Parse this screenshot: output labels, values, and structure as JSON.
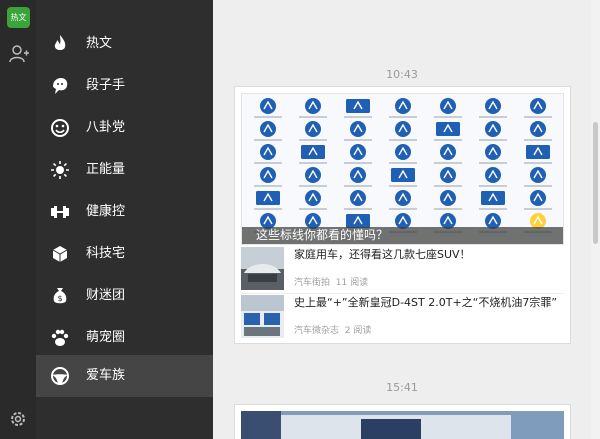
{
  "app": {
    "badge": "热文"
  },
  "categories": [
    {
      "label": "热文",
      "icon": "flame-icon",
      "selected": false
    },
    {
      "label": "段子手",
      "icon": "chat-bubble-icon",
      "selected": false
    },
    {
      "label": "八卦党",
      "icon": "smiley-icon",
      "selected": false
    },
    {
      "label": "正能量",
      "icon": "sun-icon",
      "selected": false
    },
    {
      "label": "健康控",
      "icon": "dumbbell-icon",
      "selected": false
    },
    {
      "label": "科技宅",
      "icon": "cube-icon",
      "selected": false
    },
    {
      "label": "财迷团",
      "icon": "money-bag-icon",
      "selected": false
    },
    {
      "label": "萌宠圈",
      "icon": "paw-icon",
      "selected": false
    },
    {
      "label": "爱车族",
      "icon": "steering-wheel-icon",
      "selected": true
    }
  ],
  "chat": {
    "times": [
      "10:43",
      "15:41"
    ],
    "card": {
      "headline": "这些标线你都看的懂吗？",
      "items": [
        {
          "title": "家庭用车，还得看这几款七座SUV！",
          "source": "汽车街拍",
          "reads": "11 阅读"
        },
        {
          "title": "史上最“+”全新皇冠D-4ST 2.0T+之“不烧机油7宗罪”",
          "source": "汽车微杂志",
          "reads": "2 阅读"
        }
      ]
    }
  },
  "colors": {
    "accent": "#3aa43a",
    "sidebar": "#2e2e2e",
    "selected": "#454545",
    "sign_blue": "#1f5fb4"
  }
}
